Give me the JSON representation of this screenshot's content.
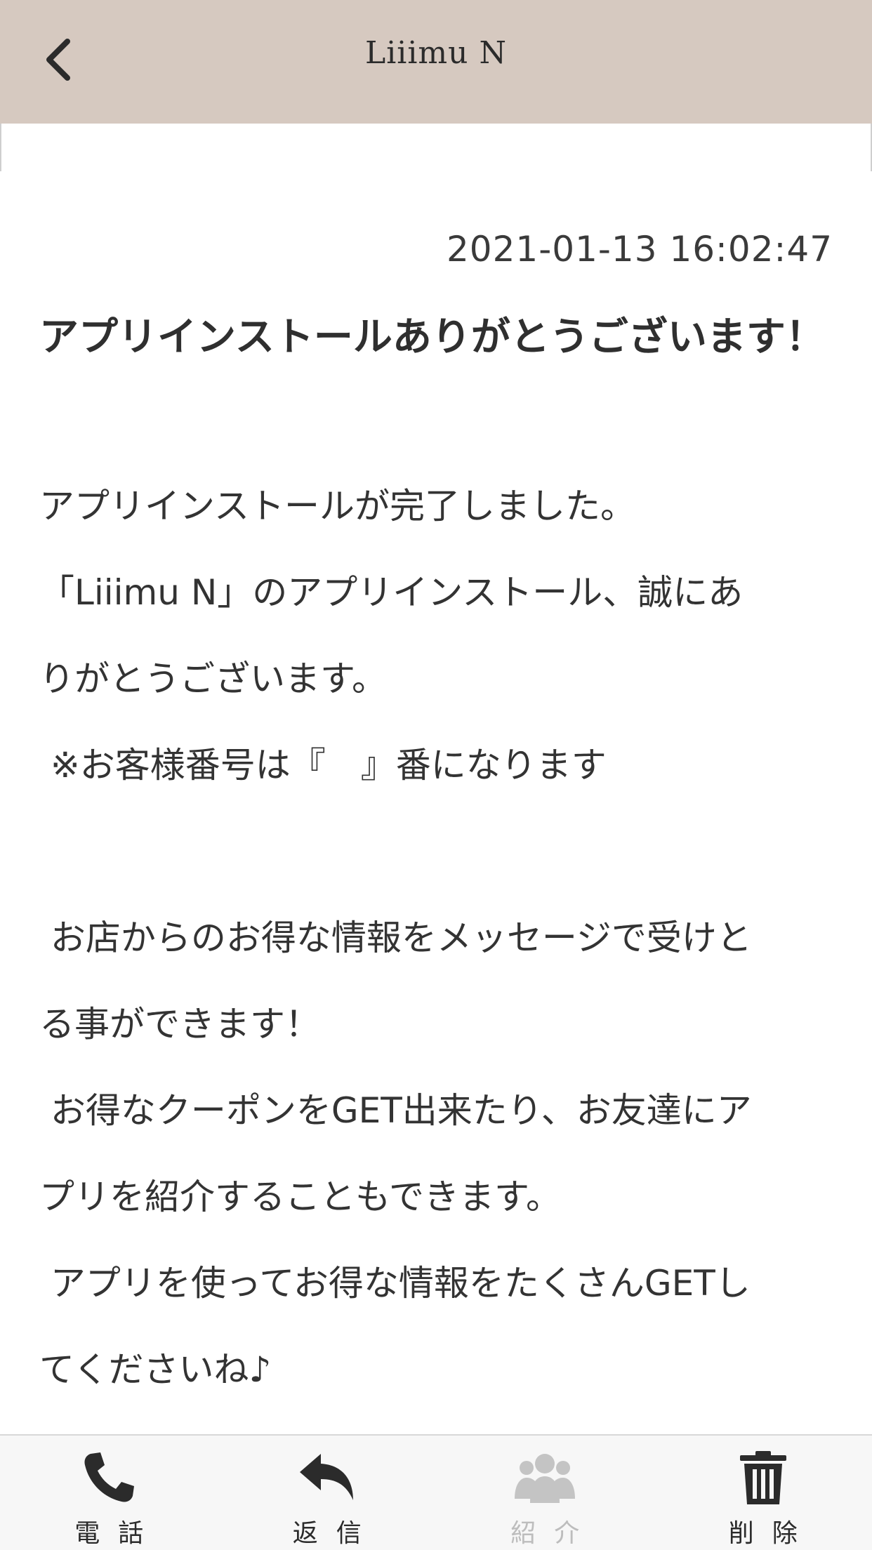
{
  "header": {
    "title": "Liiimu N",
    "back_icon": "chevron-left-icon",
    "background": "#d6c9c0"
  },
  "message": {
    "timestamp": "2021-01-13 16:02:47",
    "title": "アプリインストールありがとうございます！",
    "lines": [
      "アプリインストールが完了しました。",
      "「Liiimu N」のアプリインストール、誠にあ",
      "りがとうございます。",
      " ※お客様番号は『　』番になります",
      "",
      " お店からのお得な情報をメッセージで受けと",
      "る事ができます！",
      " お得なクーポンをGET出来たり、お友達にア",
      "プリを紹介することもできます。",
      " アプリを使ってお得な情報をたくさんGETし",
      "てくださいね♪"
    ]
  },
  "tabbar": {
    "items": [
      {
        "label": "電話",
        "icon": "phone-icon",
        "enabled": true
      },
      {
        "label": "返信",
        "icon": "reply-icon",
        "enabled": true
      },
      {
        "label": "紹介",
        "icon": "people-icon",
        "enabled": false
      },
      {
        "label": "削除",
        "icon": "trash-icon",
        "enabled": true
      }
    ],
    "active_color": "#2b2b2b",
    "disabled_color": "#bdbdbd"
  }
}
